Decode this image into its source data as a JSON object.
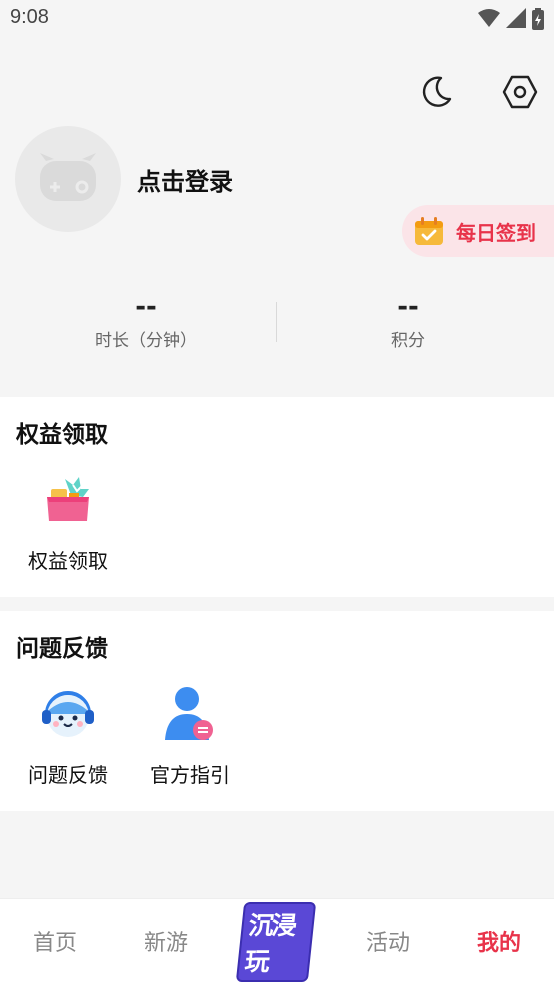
{
  "status_bar": {
    "time": "9:08",
    "icons": [
      "wifi-icon",
      "signal-icon",
      "battery-icon"
    ]
  },
  "header": {
    "icons": [
      "moon-icon",
      "settings-icon"
    ]
  },
  "profile": {
    "login_label": "点击登录",
    "avatar_icon": "gamepad-avatar-icon"
  },
  "checkin": {
    "label": "每日签到",
    "icon": "calendar-check-icon",
    "color": "#e8334a"
  },
  "stats": [
    {
      "value": "--",
      "label": "时长（分钟）"
    },
    {
      "value": "--",
      "label": "积分"
    }
  ],
  "benefits": {
    "title": "权益领取",
    "items": [
      {
        "label": "权益领取",
        "icon": "gift-box-icon"
      }
    ]
  },
  "feedback": {
    "title": "问题反馈",
    "items": [
      {
        "label": "问题反馈",
        "icon": "support-mascot-icon"
      },
      {
        "label": "官方指引",
        "icon": "official-guide-icon"
      }
    ]
  },
  "tabbar": {
    "tabs": [
      {
        "label": "首页",
        "active": false
      },
      {
        "label": "新游",
        "active": false
      },
      {
        "label": "沉浸玩",
        "active": false
      },
      {
        "label": "活动",
        "active": false
      },
      {
        "label": "我的",
        "active": true
      }
    ]
  },
  "colors": {
    "accent": "#e8334a",
    "background": "#f5f5f5",
    "brand_purple": "#5a48d6"
  }
}
